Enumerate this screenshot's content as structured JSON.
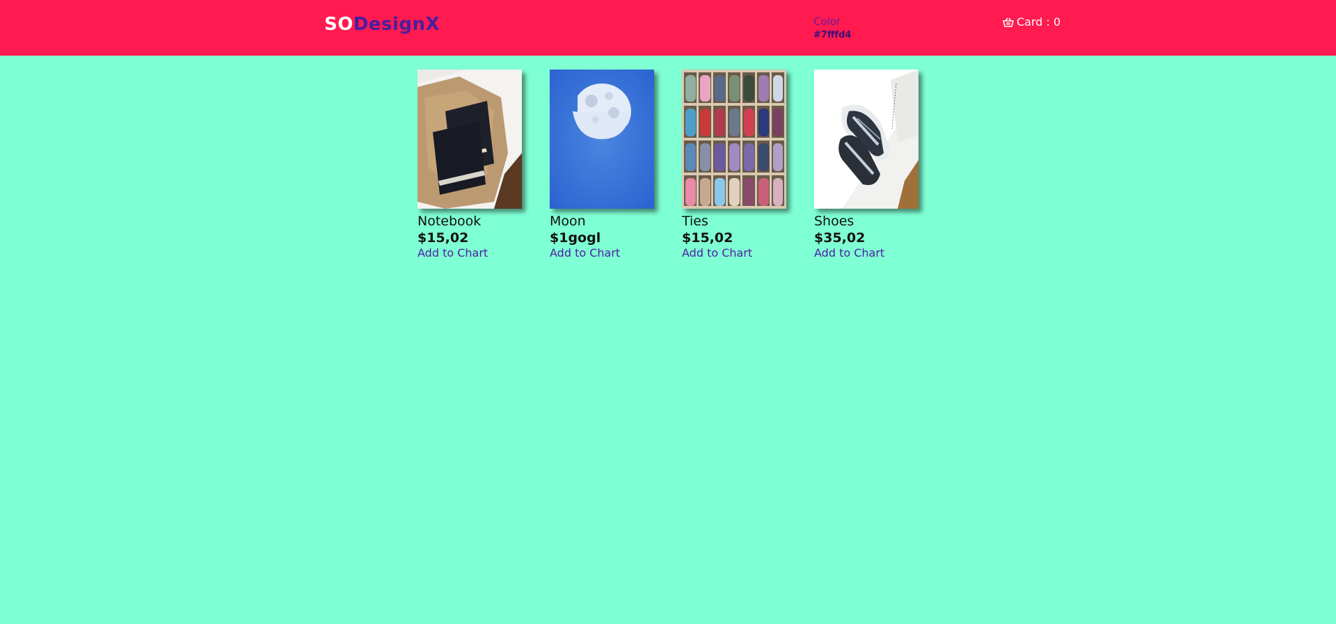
{
  "header": {
    "logo_prefix": "SO",
    "logo_suffix": "DesignX",
    "color_label": "Color",
    "color_value": "#7fffd4",
    "cart_label": "Card : 0",
    "cart_icon": "basket-icon"
  },
  "colors": {
    "header_bg": "#ff1a50",
    "page_bg": "#7fffd4",
    "accent": "#4a1ea0"
  },
  "products": [
    {
      "name": "Notebook",
      "price": "$15,02",
      "action": "Add to Chart",
      "image": "notebook-image"
    },
    {
      "name": "Moon",
      "price": "$1gogl",
      "action": "Add to Chart",
      "image": "moon-image"
    },
    {
      "name": "Ties",
      "price": "$15,02",
      "action": "Add to Chart",
      "image": "ties-image"
    },
    {
      "name": "Shoes",
      "price": "$35,02",
      "action": "Add to Chart",
      "image": "shoes-image"
    }
  ]
}
